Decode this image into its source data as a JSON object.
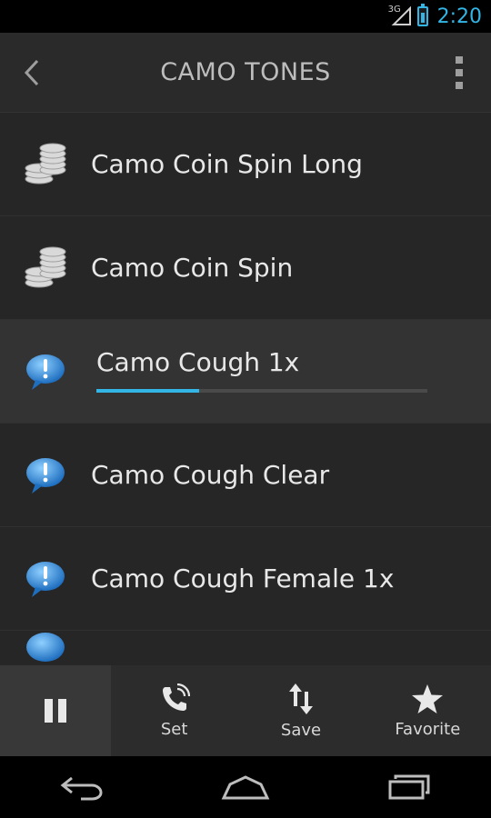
{
  "status_bar": {
    "network": "3G",
    "time": "2:20",
    "accent_color": "#33b5e5"
  },
  "action_bar": {
    "title": "CAMO TONES",
    "back_icon": "back-chevron-icon",
    "overflow_icon": "overflow-menu-icon"
  },
  "list": {
    "items": [
      {
        "label": "Camo Coin Spin Long",
        "icon": "coin-stack-icon"
      },
      {
        "label": "Camo Coin Spin",
        "icon": "coin-stack-icon"
      },
      {
        "label": "Camo Cough 1x",
        "icon": "speech-bubble-icon",
        "playing": true,
        "progress": 0.31
      },
      {
        "label": "Camo Cough Clear",
        "icon": "speech-bubble-icon"
      },
      {
        "label": "Camo Cough Female 1x",
        "icon": "speech-bubble-icon"
      }
    ]
  },
  "bottom_bar": {
    "pause_icon": "pause-icon",
    "set_label": "Set",
    "save_label": "Save",
    "favorite_label": "Favorite"
  },
  "nav_bar": {
    "back_icon": "nav-back-icon",
    "home_icon": "nav-home-icon",
    "recents_icon": "nav-recents-icon"
  }
}
